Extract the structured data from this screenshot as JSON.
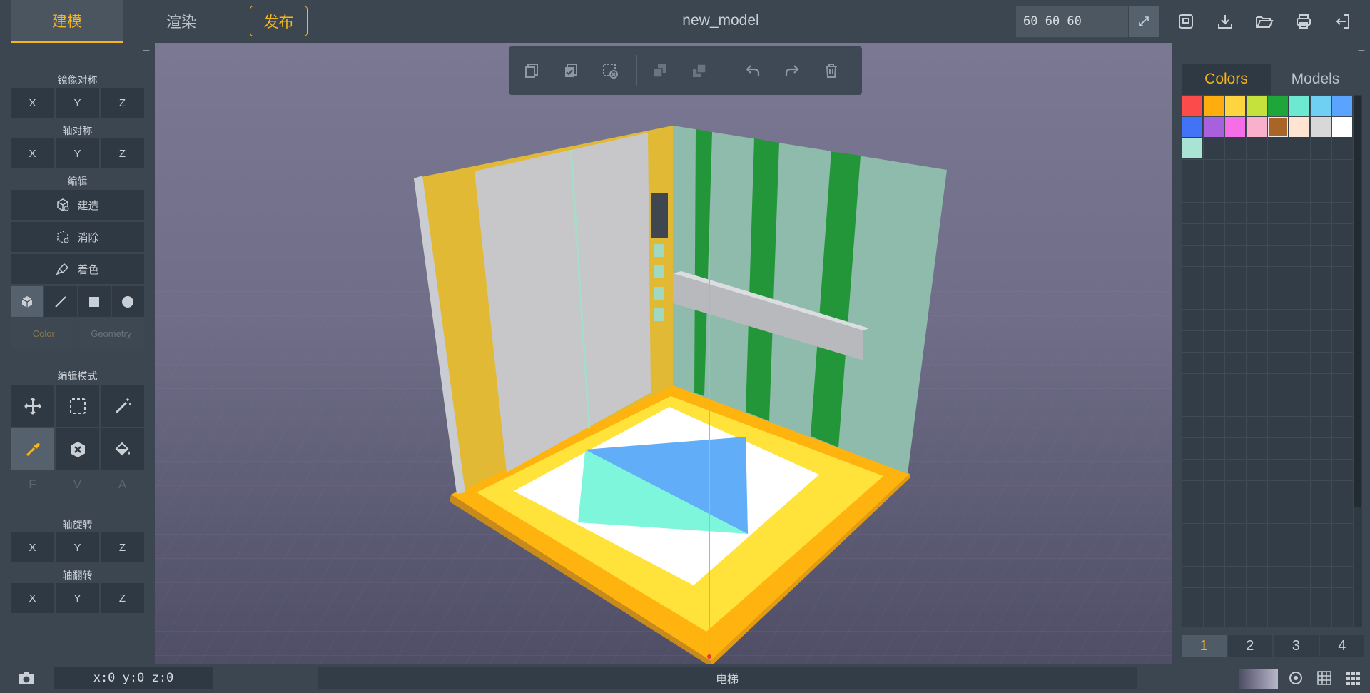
{
  "header": {
    "tabs": {
      "model": "建模",
      "render": "渲染"
    },
    "publish": "发布",
    "title": "new_model",
    "dimensions": "60 60 60"
  },
  "left_panel": {
    "mirror": {
      "title": "镜像对称",
      "axes": [
        "X",
        "Y",
        "Z"
      ]
    },
    "axis_sym": {
      "title": "轴对称",
      "axes": [
        "X",
        "Y",
        "Z"
      ]
    },
    "edit": {
      "title": "编辑",
      "build": "建造",
      "erase": "消除",
      "paint": "着色"
    },
    "shape_tabs": {
      "color": "Color",
      "geometry": "Geometry"
    },
    "edit_mode": {
      "title": "编辑模式"
    },
    "fva": [
      "F",
      "V",
      "A"
    ],
    "axis_rotate": {
      "title": "轴旋转",
      "axes": [
        "X",
        "Y",
        "Z"
      ]
    },
    "axis_flip": {
      "title": "轴翻转",
      "axes": [
        "X",
        "Y",
        "Z"
      ]
    }
  },
  "right_panel": {
    "tabs": {
      "colors": "Colors",
      "models": "Models"
    },
    "palette": [
      "#fc4b4b",
      "#ffac0e",
      "#ffd53f",
      "#c4e23b",
      "#1fa63a",
      "#6de8d1",
      "#6fd0f3",
      "#5aa4ff",
      "#4272f6",
      "#a960dd",
      "#f56ee8",
      "#f9b0cd",
      "#a86527",
      "#ffe4d1",
      "#d8d8d8",
      "#ffffff",
      "#a9e3d4"
    ],
    "selected_index": 12,
    "pages": [
      "1",
      "2",
      "3",
      "4"
    ],
    "active_page": 0
  },
  "status": {
    "coords": "x:0 y:0 z:0",
    "model_name": "电梯"
  },
  "accent_color": "#f5b51b"
}
